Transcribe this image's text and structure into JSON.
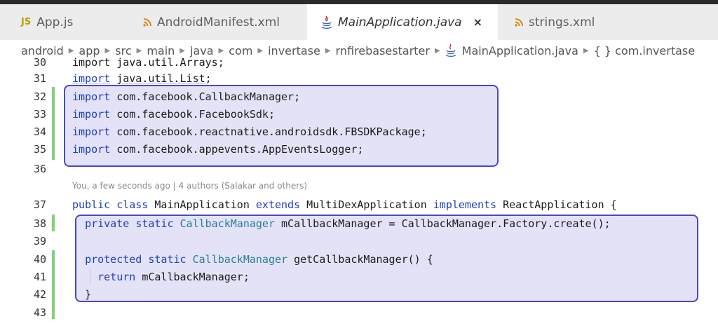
{
  "tabs": [
    {
      "label": "App.js",
      "icon": "js-file-icon",
      "active": false
    },
    {
      "label": "AndroidManifest.xml",
      "icon": "rss-file-icon",
      "active": false
    },
    {
      "label": "MainApplication.java",
      "icon": "java-file-icon",
      "active": true
    },
    {
      "label": "strings.xml",
      "icon": "rss-file-icon",
      "active": false
    }
  ],
  "tab_close_glyph": "×",
  "breadcrumb": {
    "items": [
      "android",
      "app",
      "src",
      "main",
      "java",
      "com",
      "invertase",
      "rnfirebasestarter",
      "MainApplication.java",
      "{ } com.invertase"
    ],
    "separator": "▶"
  },
  "blame_annotation": "You, a few seconds ago | 4 authors (Salakar and others)",
  "lines": [
    {
      "num": "30",
      "text": "import java.util.Arrays;"
    },
    {
      "num": "31",
      "text": "import java.util.List;"
    },
    {
      "num": "32",
      "text": "import com.facebook.CallbackManager;"
    },
    {
      "num": "33",
      "text": "import com.facebook.FacebookSdk;"
    },
    {
      "num": "34",
      "text": "import com.facebook.reactnative.androidsdk.FBSDKPackage;"
    },
    {
      "num": "35",
      "text": "import com.facebook.appevents.AppEventsLogger;"
    },
    {
      "num": "36",
      "text": ""
    },
    {
      "num": "37",
      "text": "public class MainApplication extends MultiDexApplication implements ReactApplication {"
    },
    {
      "num": "38",
      "text": "  private static CallbackManager mCallbackManager = CallbackManager.Factory.create();"
    },
    {
      "num": "39",
      "text": ""
    },
    {
      "num": "40",
      "text": "  protected static CallbackManager getCallbackManager() {"
    },
    {
      "num": "41",
      "text": "    return mCallbackManager;"
    },
    {
      "num": "42",
      "text": "  }"
    },
    {
      "num": "43",
      "text": ""
    }
  ],
  "colors": {
    "keyword": "#1d3ec6",
    "class_name": "#267f99",
    "git_added": "#7fd17b",
    "highlight_border": "#4a46c8",
    "rss_icon": "#e07b00",
    "js_icon": "#b8a100"
  }
}
